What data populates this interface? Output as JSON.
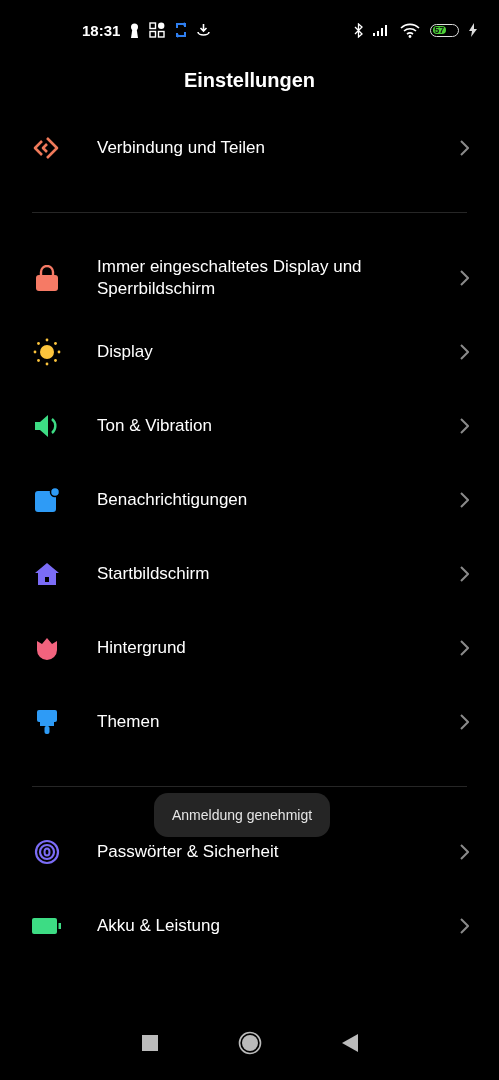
{
  "status_bar": {
    "time": "18:31",
    "battery": "57",
    "charging": true
  },
  "title": "Einstellungen",
  "groups": [
    {
      "items": [
        {
          "kind": "connection",
          "label": "Verbindung und Teilen"
        }
      ]
    },
    {
      "items": [
        {
          "kind": "lock",
          "label": "Immer eingeschaltetes Display und Sperrbildschirm"
        },
        {
          "kind": "sun",
          "label": "Display"
        },
        {
          "kind": "speaker",
          "label": "Ton & Vibration"
        },
        {
          "kind": "notification",
          "label": "Benachrichtigungen"
        },
        {
          "kind": "home",
          "label": "Startbildschirm"
        },
        {
          "kind": "tulip",
          "label": "Hintergrund"
        },
        {
          "kind": "brush",
          "label": "Themen"
        }
      ]
    },
    {
      "items": [
        {
          "kind": "fingerprint",
          "label": "Passwörter & Sicherheit"
        },
        {
          "kind": "battery",
          "label": "Akku & Leistung"
        }
      ]
    }
  ],
  "toast": "Anmeldung genehmigt"
}
